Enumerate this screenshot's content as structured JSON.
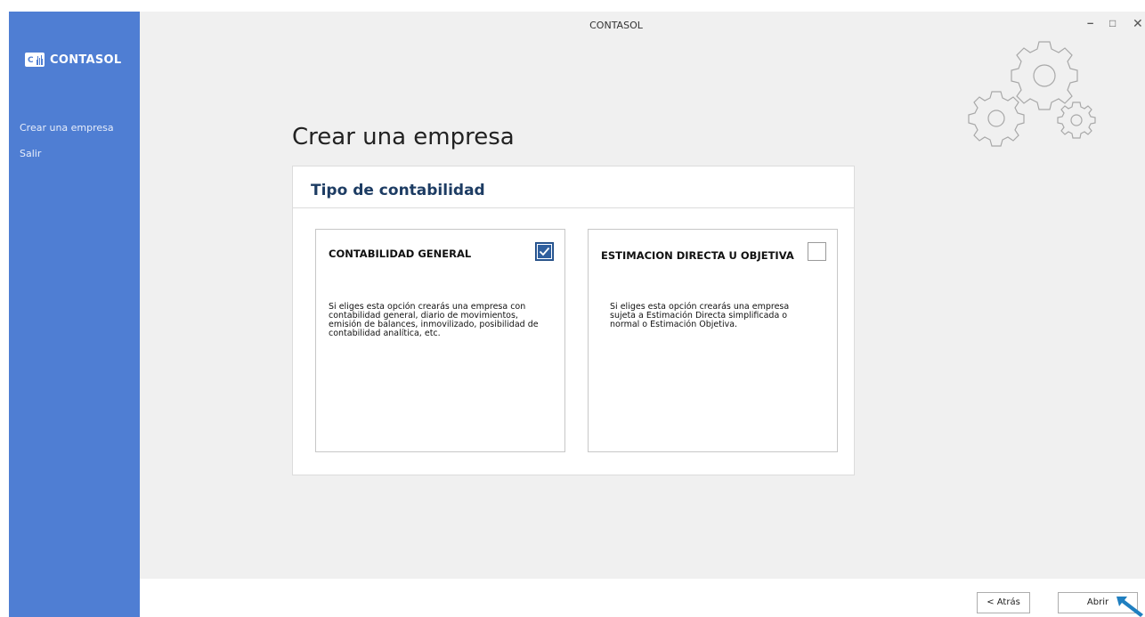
{
  "app": {
    "window_title": "CONTASOL",
    "brand_name": "CONTASOL",
    "logo_letter": "C",
    "accent_color": "#4f7ed3"
  },
  "sidebar": {
    "items": [
      {
        "label": "Crear una empresa"
      },
      {
        "label": "Salir"
      }
    ]
  },
  "window_controls": {
    "minimize": "–",
    "maximize": "□",
    "close": "✕"
  },
  "main": {
    "page_title": "Crear una empresa",
    "panel_title": "Tipo de contabilidad",
    "decoration_icon": "gears-icon",
    "options": [
      {
        "title": "CONTABILIDAD GENERAL",
        "checked": true,
        "description": "Si eliges esta opción crearás una empresa con contabilidad general, diario de movimientos, emisión de balances, inmovilizado, posibilidad de contabilidad analítica, etc."
      },
      {
        "title": "ESTIMACION DIRECTA U OBJETIVA",
        "checked": false,
        "description": "Si eliges esta opción crearás una empresa sujeta a Estimación Directa simplificada o normal o Estimación Objetiva."
      }
    ]
  },
  "footer": {
    "back_label": "< Atrás",
    "open_label": "Abrir"
  }
}
